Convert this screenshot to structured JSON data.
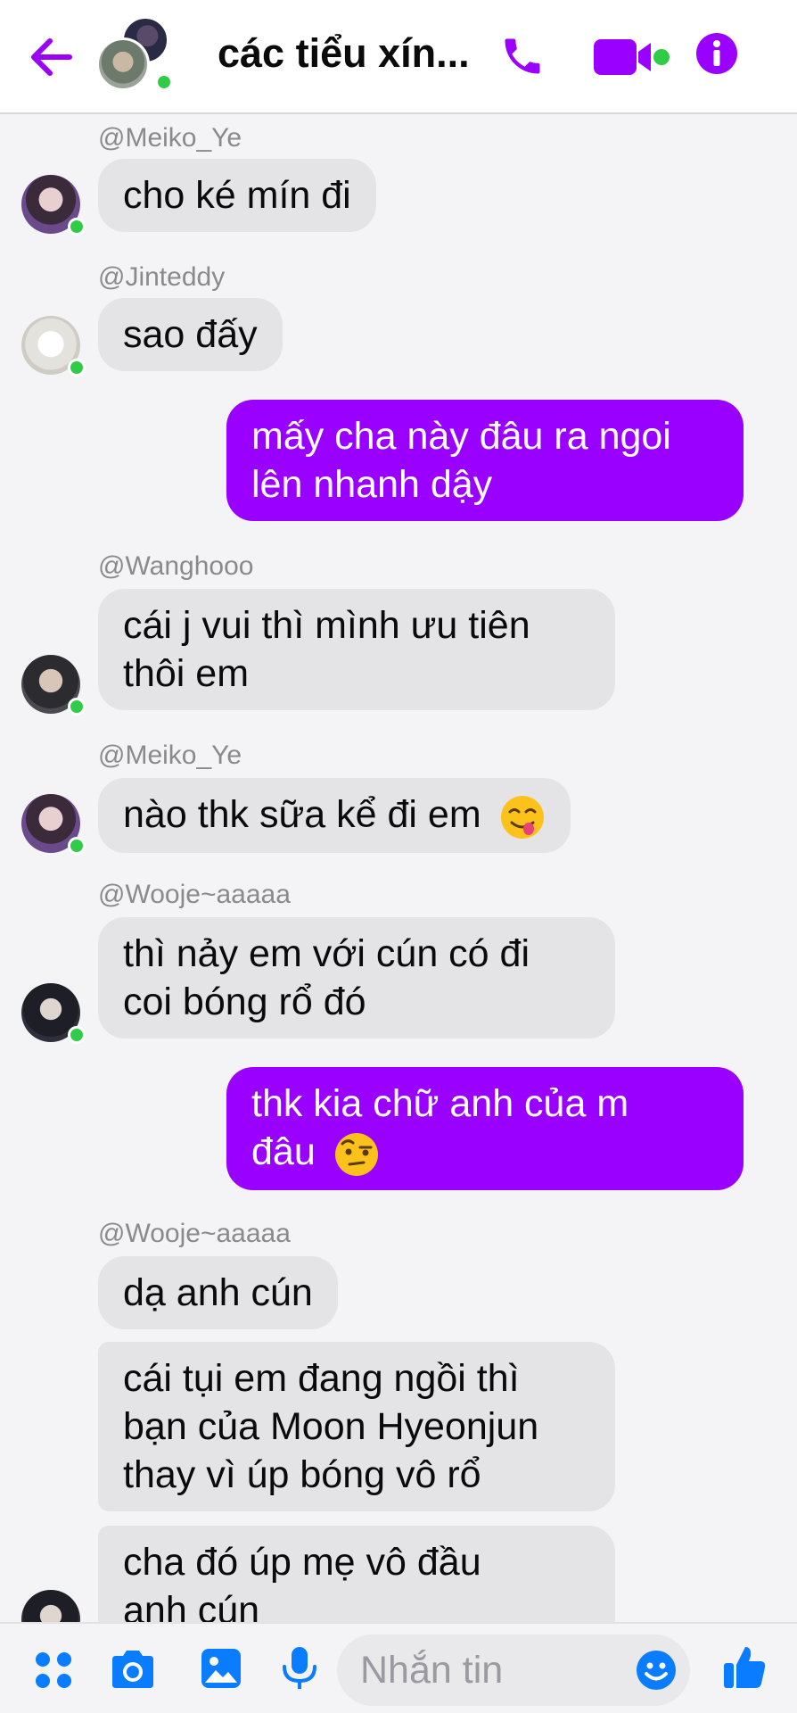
{
  "header": {
    "title": "các tiểu xín...",
    "icons": [
      "back-arrow-icon",
      "phone-icon",
      "video-camera-icon",
      "info-icon"
    ],
    "accent_color": "#9a00ff",
    "online_color": "#31cc46"
  },
  "messages": [
    {
      "sender": "@Meiko_Ye",
      "lines": [
        "cho ké mín đi"
      ],
      "direction": "in"
    },
    {
      "sender": "@Jinteddy",
      "lines": [
        "sao đấy"
      ],
      "direction": "in"
    },
    {
      "sender": "",
      "lines": [
        "mấy cha này đâu ra ngoi",
        "lên nhanh dậy"
      ],
      "direction": "out"
    },
    {
      "sender": "@Wanghooo",
      "lines": [
        "cái j vui thì mình ưu tiên",
        "thôi em"
      ],
      "direction": "in"
    },
    {
      "sender": "@Meiko_Ye",
      "lines": [
        "nào thk sữa kể đi em"
      ],
      "emoji": "smiling-face-savoring-food",
      "direction": "in"
    },
    {
      "sender": "@Wooje~aaaaa",
      "lines": [
        "thì nảy em với cún có đi",
        "coi bóng rổ đó"
      ],
      "direction": "in"
    },
    {
      "sender": "",
      "lines": [
        "thk kia chữ anh của m",
        "đâu"
      ],
      "emoji": "face-with-raised-eyebrow",
      "direction": "out"
    },
    {
      "sender": "@Wooje~aaaaa",
      "lines": [
        "dạ anh cún"
      ],
      "direction": "in"
    },
    {
      "sender": "",
      "lines": [
        "cái tụi em đang ngồi thì",
        "bạn của Moon Hyeonjun",
        "thay vì úp bóng vô rổ"
      ],
      "direction": "in"
    },
    {
      "sender": "",
      "lines": [
        "cha đó úp mẹ vô đầu",
        "anh cún"
      ],
      "direction": "in"
    }
  ],
  "composer": {
    "placeholder": "Nhắn tin",
    "icons": [
      "apps-icon",
      "camera-icon",
      "image-icon",
      "microphone-icon",
      "emoji-icon",
      "thumbs-up-icon"
    ]
  }
}
